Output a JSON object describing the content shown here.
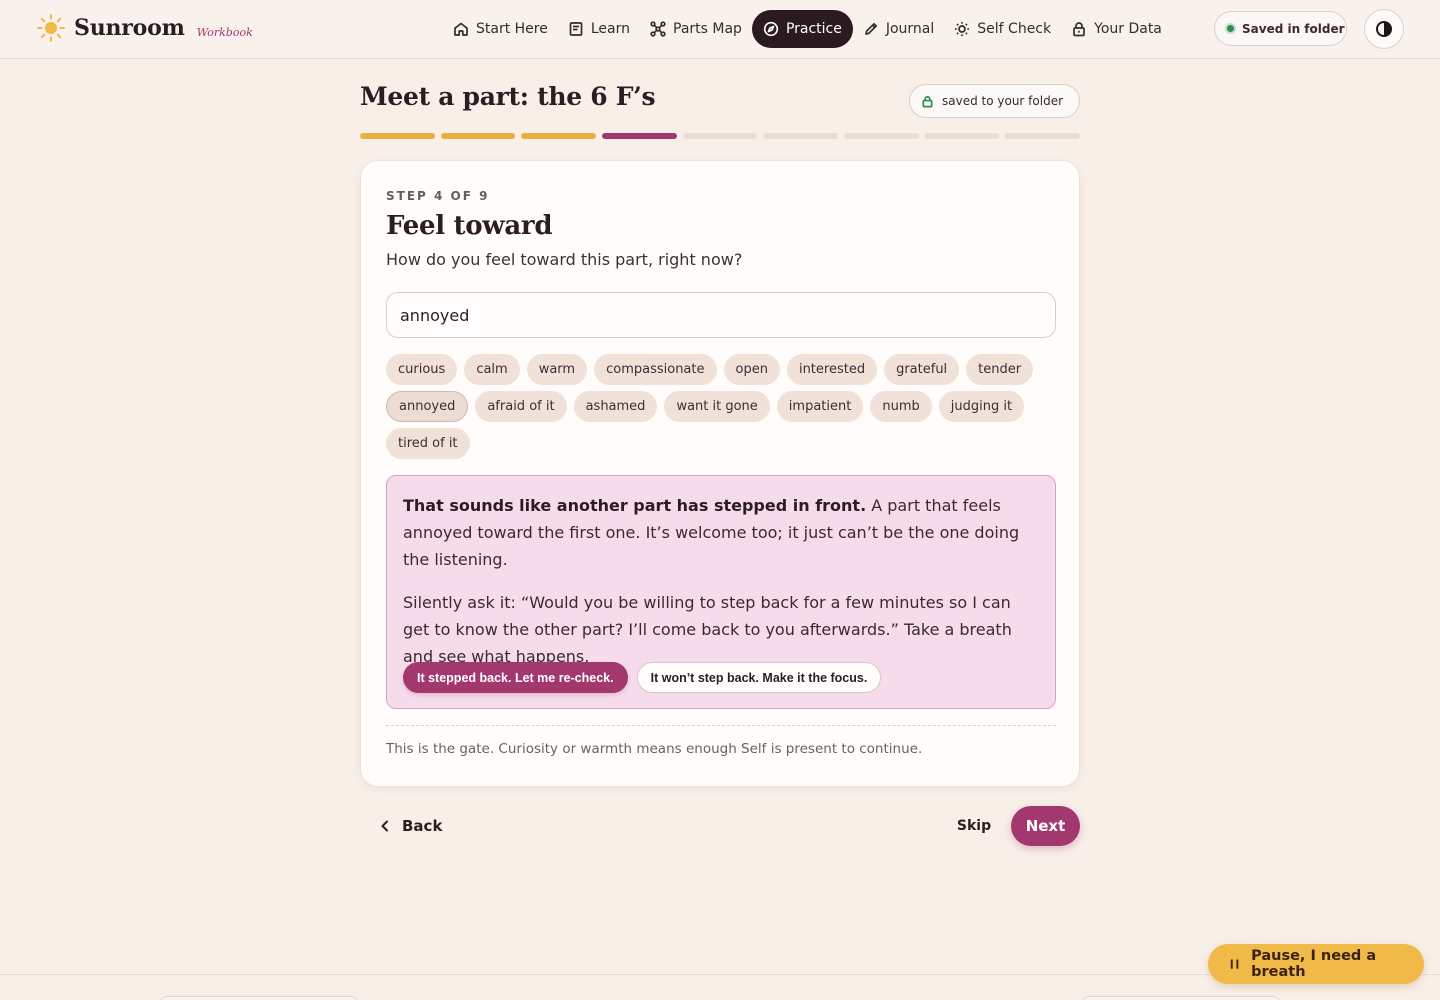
{
  "app": {
    "name": "Sunroom",
    "tag": "Workbook"
  },
  "nav": {
    "items": [
      {
        "label": "Start Here",
        "icon": "home-icon"
      },
      {
        "label": "Learn",
        "icon": "book-icon"
      },
      {
        "label": "Parts Map",
        "icon": "network-icon"
      },
      {
        "label": "Practice",
        "icon": "compass-icon",
        "active": true
      },
      {
        "label": "Journal",
        "icon": "pencil-icon"
      },
      {
        "label": "Self Check",
        "icon": "sun-icon"
      },
      {
        "label": "Your Data",
        "icon": "lock-icon"
      }
    ],
    "saved_status": "Saved in folder",
    "contrast_toggle_icon": "contrast-icon"
  },
  "page": {
    "title": "Meet a part: the 6 F’s",
    "folder_badge": "saved to your folder",
    "progress": {
      "total_steps": 9,
      "current_step": 4,
      "completed_steps": 3
    }
  },
  "step": {
    "label": "STEP 4 OF 9",
    "title": "Feel toward",
    "question": "How do you feel toward this part, right now?",
    "input_value": "annoyed",
    "chips_row1": [
      "curious",
      "calm",
      "warm",
      "compassionate",
      "open",
      "interested",
      "grateful",
      "tender"
    ],
    "chips_row2": [
      "annoyed",
      "afraid of it",
      "ashamed",
      "want it gone",
      "impatient",
      "numb",
      "judging it"
    ],
    "chips_row3": [
      "tired of it"
    ],
    "selected_chip": "annoyed",
    "notice": {
      "bold": "That sounds like another part has stepped in front.",
      "rest": " A part that feels annoyed toward the first one. It’s welcome too; it just can’t be the one doing the listening.",
      "second": "Silently ask it: “Would you be willing to step back for a few minutes so I can get to know the other part? I’ll come back to you afterwards.” Take a breath and see what happens.",
      "primary_action": "It stepped back. Let me re-check.",
      "secondary_action": "It won’t step back. Make it the focus."
    },
    "gate_note": "This is the gate. Curiosity or warmth means enough Self is present to continue."
  },
  "footer": {
    "back": "Back",
    "skip": "Skip",
    "next": "Next",
    "pause": "Pause, I need a breath"
  },
  "colors": {
    "background": "#f8efe9",
    "accent": "#a3386f",
    "progress_done": "#e8b13f",
    "nav_active": "#2b1a20",
    "pause": "#f1b947",
    "saved_dot": "#2f8a55"
  }
}
